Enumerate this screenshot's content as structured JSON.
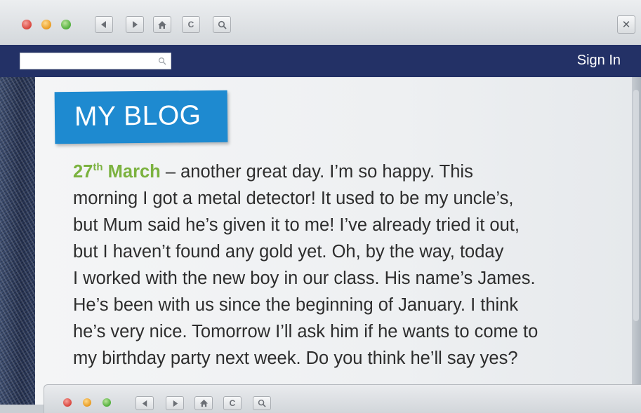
{
  "browser": {
    "toolbar_icons": [
      "back-icon",
      "forward-icon",
      "home-icon",
      "refresh-icon",
      "search-icon"
    ],
    "close_label": "✕",
    "refresh_label": "C"
  },
  "navbar": {
    "search_placeholder": "",
    "signin_label": "Sign In"
  },
  "blog": {
    "title": "MY BLOG",
    "post": {
      "date_day": "27",
      "date_suffix": "th",
      "date_month": "March",
      "lines": [
        " – another great day. I’m so happy. This",
        "morning I got a metal detector! It used to be my uncle’s,",
        "but Mum said he’s given it to me! I’ve already tried it out,",
        "but I haven’t found any gold yet. Oh, by the way, today",
        "I worked with the new boy in our class. His name’s James.",
        "He’s been with us since the beginning of January. I think",
        "he’s very nice. Tomorrow I’ll ask him if he wants to come to",
        "my birthday party next week. Do you think he’ll say yes?"
      ]
    }
  },
  "colors": {
    "navbar": "#233166",
    "title_box": "#1e8ad0",
    "date": "#7bb23f"
  }
}
